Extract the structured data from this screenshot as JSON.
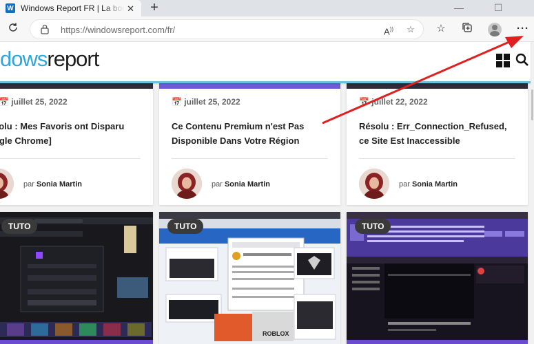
{
  "browser": {
    "tab_title": "Windows Report FR | La bonne v",
    "favicon_letter": "W",
    "new_tab_symbol": "+",
    "url": "https://windowsreport.com/fr/",
    "window_controls": [
      "—",
      "☐"
    ]
  },
  "site": {
    "logo_part1": "dows",
    "logo_part2": "report",
    "accent_color": "#2ea6dd"
  },
  "articles": [
    {
      "date": "juillet 25, 2022",
      "title": "Résolu : Mes Favoris ont Disparu de Google Chrome]",
      "title_visible": "solu : Mes Favoris ont Disparu\nogle Chrome]",
      "author_prefix": "par",
      "author": "Sonia Martin"
    },
    {
      "date": "juillet 25, 2022",
      "title": "Ce Contenu Premium n'est Pas Disponible Dans Votre Région",
      "author_prefix": "par",
      "author": "Sonia Martin"
    },
    {
      "date": "juillet 22, 2022",
      "title": "Résolu : Err_Connection_Refused, ce Site Est Inaccessible",
      "author_prefix": "par",
      "author": "Sonia Martin"
    }
  ],
  "tuto_label": "TUTO",
  "annotation": {
    "arrow_color": "#e02020"
  }
}
